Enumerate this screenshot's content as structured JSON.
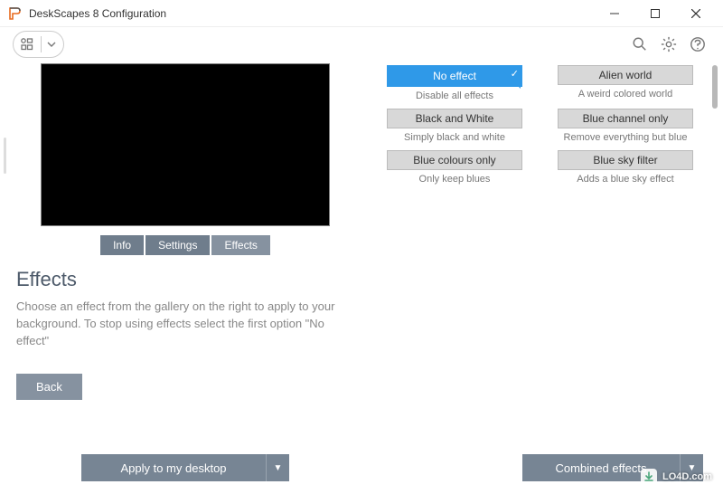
{
  "window": {
    "title": "DeskScapes 8 Configuration"
  },
  "tabs": {
    "info": "Info",
    "settings": "Settings",
    "effects": "Effects"
  },
  "effects_panel": {
    "heading": "Effects",
    "description": "Choose an effect from the gallery on the right to apply to your background.  To stop using effects select the first option \"No effect\"",
    "back": "Back"
  },
  "buttons": {
    "apply": "Apply to my desktop",
    "combined": "Combined effects"
  },
  "gallery": [
    {
      "label": "No effect",
      "caption": "Disable all effects",
      "selected": true
    },
    {
      "label": "Alien world",
      "caption": "A weird colored world",
      "selected": false
    },
    {
      "label": "Black and White",
      "caption": "Simply black and white",
      "selected": false
    },
    {
      "label": "Blue channel only",
      "caption": "Remove everything but blue",
      "selected": false
    },
    {
      "label": "Blue colours only",
      "caption": "Only keep blues",
      "selected": false
    },
    {
      "label": "Blue sky filter",
      "caption": "Adds a blue sky effect",
      "selected": false
    }
  ],
  "watermark": "LO4D.com"
}
